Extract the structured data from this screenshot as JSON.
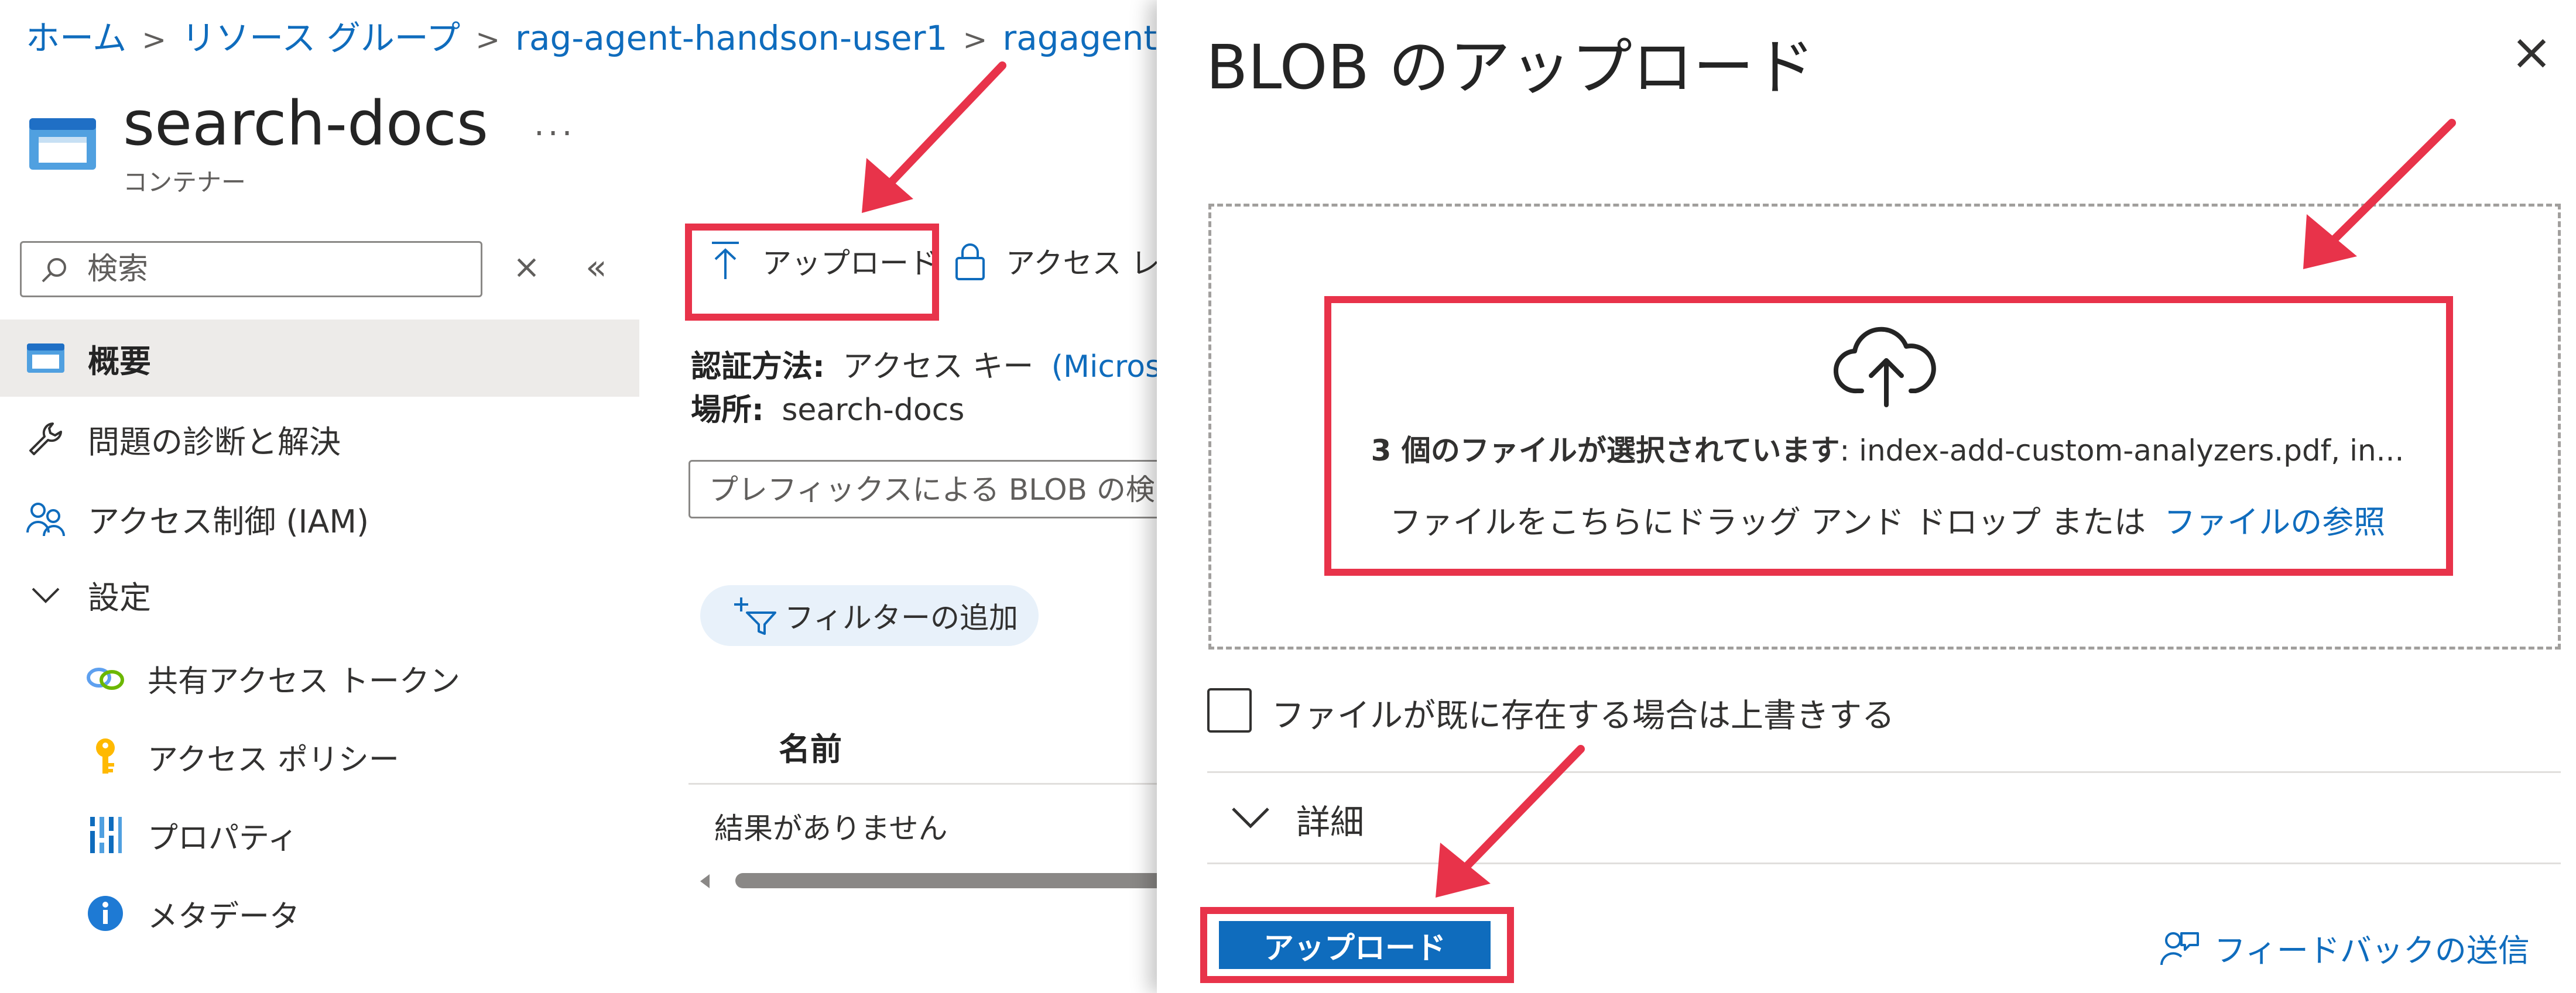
{
  "breadcrumb": {
    "items": [
      "ホーム",
      "リソース グループ",
      "rag-agent-handson-user1",
      "ragagenthand"
    ],
    "separator": ">"
  },
  "resource": {
    "title": "search-docs",
    "subtitle": "コンテナー",
    "more_label": "..."
  },
  "sidebar": {
    "search_placeholder": "検索",
    "clear_label": "×",
    "collapse_label": "«",
    "items": [
      {
        "label": "概要",
        "icon": "container-icon",
        "active": true
      },
      {
        "label": "問題の診断と解決",
        "icon": "wrench-icon"
      },
      {
        "label": "アクセス制御 (IAM)",
        "icon": "people-icon"
      },
      {
        "label": "設定",
        "icon": "chevron-down-icon"
      }
    ],
    "sub_items": [
      {
        "label": "共有アクセス トークン",
        "icon": "link-icon"
      },
      {
        "label": "アクセス ポリシー",
        "icon": "key-icon"
      },
      {
        "label": "プロパティ",
        "icon": "properties-icon"
      },
      {
        "label": "メタデータ",
        "icon": "info-icon"
      }
    ]
  },
  "toolbar": {
    "upload_label": "アップロード",
    "access_label": "アクセス レベ"
  },
  "main": {
    "auth_label": "認証方法:",
    "auth_value": "アクセス キー",
    "auth_link": "(Microso",
    "location_label": "場所:",
    "location_value": "search-docs",
    "prefix_placeholder": "プレフィックスによる BLOB の検索 (",
    "filter_label": "フィルターの追加",
    "column_name": "名前",
    "empty_text": "結果がありません"
  },
  "panel": {
    "title": "BLOB のアップロード",
    "close_label": "×",
    "selected_count_text": "3 個のファイルが選択されています",
    "selected_files_text": ": index-add-custom-analyzers.pdf, in...",
    "drop_hint": "ファイルをこちらにドラッグ アンド ドロップ または",
    "browse_link": "ファイルの参照",
    "overwrite_label": "ファイルが既に存在する場合は上書きする",
    "overwrite_checked": false,
    "details_label": "詳細",
    "upload_button": "アップロード",
    "feedback_label": "フィードバックの送信"
  },
  "colors": {
    "accent": "#0f6cbd",
    "highlight": "#e8334a"
  }
}
